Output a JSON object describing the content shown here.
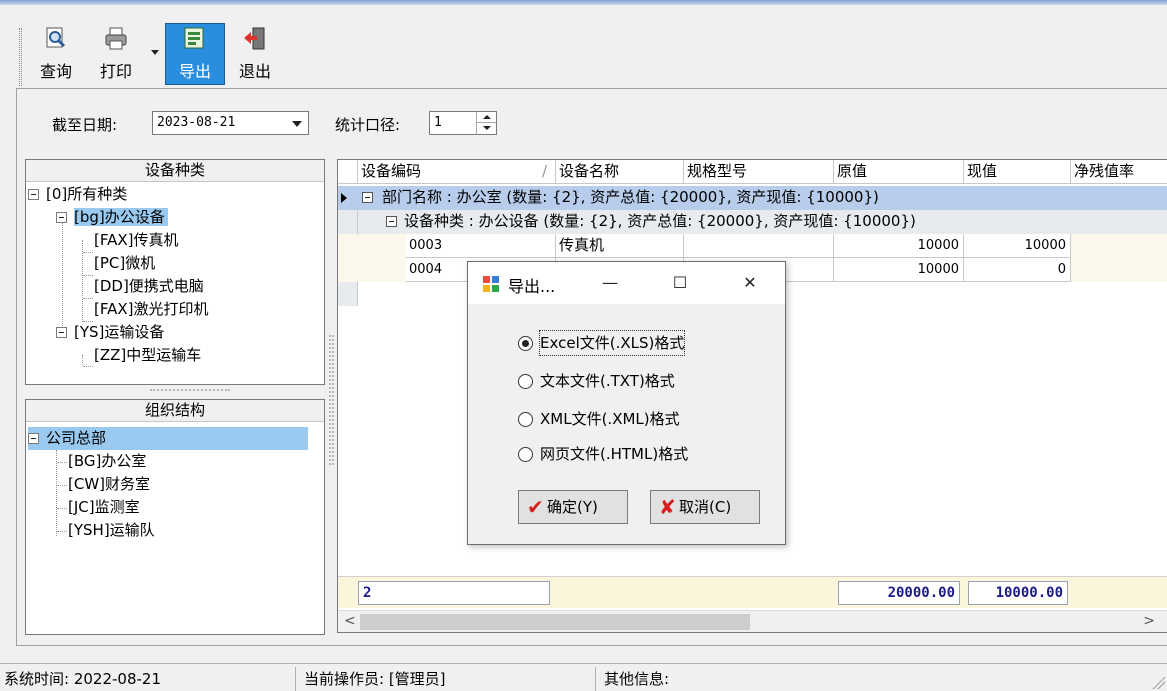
{
  "toolbar": {
    "query": "查询",
    "print": "打印",
    "export": "导出",
    "exit": "退出"
  },
  "filters": {
    "date_label": "截至日期:",
    "date_value": "2023-08-21",
    "caliber_label": "统计口径:",
    "caliber_value": "1"
  },
  "category_tree": {
    "header": "设备种类",
    "nodes": [
      "[0]所有种类",
      "[bg]办公设备",
      "[FAX]传真机",
      "[PC]微机",
      "[DD]便携式电脑",
      "[FAX]激光打印机",
      "[YS]运输设备",
      "[ZZ]中型运输车"
    ]
  },
  "org_tree": {
    "header": "组织结构",
    "nodes": [
      "公司总部",
      "[BG]办公室",
      "[CW]财务室",
      "[JC]监测室",
      "[YSH]运输队"
    ]
  },
  "grid": {
    "columns": [
      "设备编码",
      "设备名称",
      "规格型号",
      "原值",
      "现值",
      "净残值率"
    ],
    "group1": "部门名称 : 办公室 (数量: {2}, 资产总值: {20000}, 资产现值: {10000})",
    "group2": "设备种类 : 办公设备 (数量: {2}, 资产总值: {20000}, 资产现值: {10000})",
    "rows": [
      {
        "code": "0003",
        "name": "传真机",
        "spec": "",
        "original": "10000",
        "current": "10000"
      },
      {
        "code": "0004",
        "name": "",
        "spec": "",
        "original": "10000",
        "current": "0"
      }
    ],
    "footer": {
      "count": "2",
      "original_total": "20000.00",
      "current_total": "10000.00"
    }
  },
  "dialog": {
    "title": "导出...",
    "options": [
      "Excel文件(.XLS)格式",
      "文本文件(.TXT)格式",
      "XML文件(.XML)格式",
      "网页文件(.HTML)格式"
    ],
    "selected_index": 0,
    "ok": "确定(Y)",
    "cancel": "取消(C)"
  },
  "status": {
    "system_time": "系统时间: 2022-08-21",
    "operator": "当前操作员: [管理员]",
    "other": "其他信息:"
  }
}
